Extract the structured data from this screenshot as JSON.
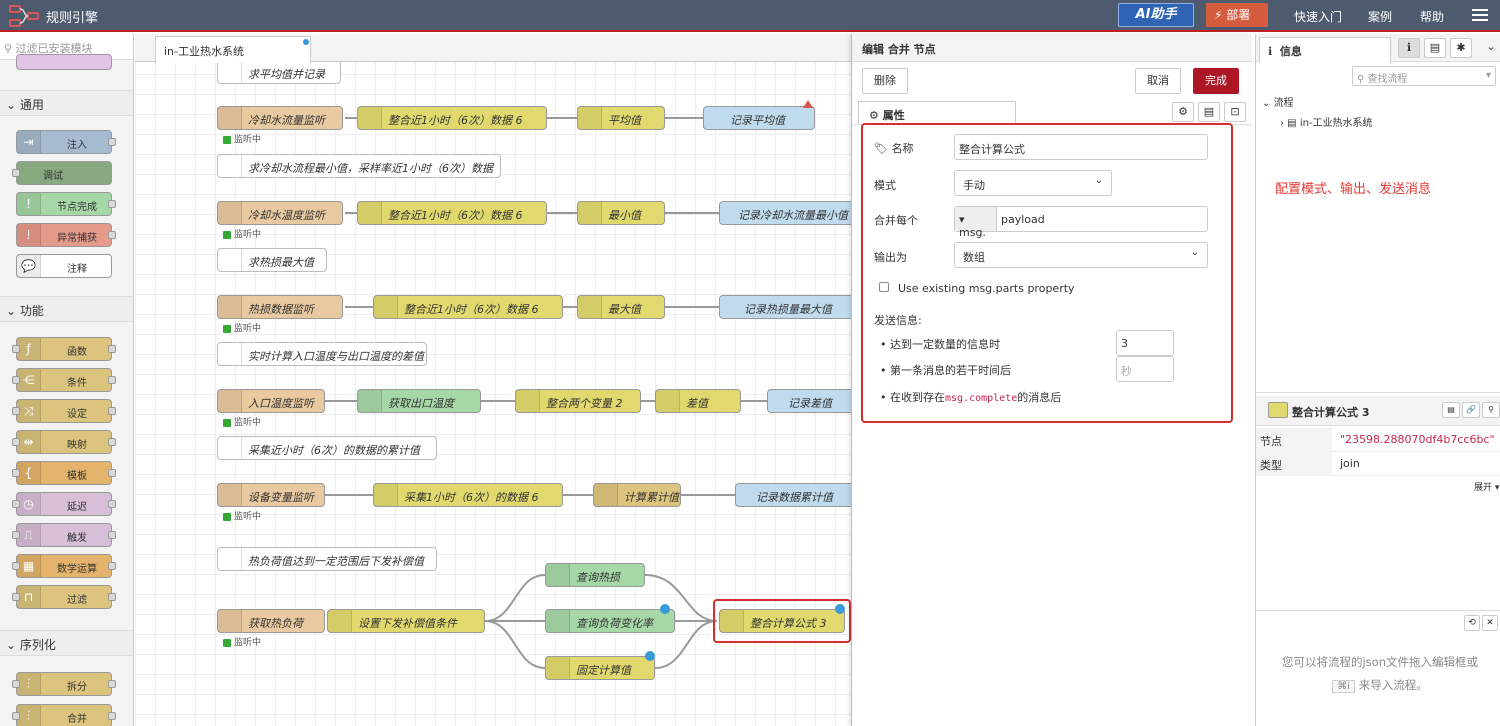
{
  "app": {
    "title": "规则引擎"
  },
  "header": {
    "ai_button": "AI助手",
    "deploy": "部署",
    "quick_start": "快速入门",
    "cases": "案例",
    "help": "帮助"
  },
  "palette": {
    "filter_placeholder": "过滤已安装模块",
    "categories": [
      {
        "label": "通用",
        "nodes": [
          "注入",
          "调试",
          "节点完成",
          "异常捕获",
          "注释"
        ]
      },
      {
        "label": "功能",
        "nodes": [
          "函数",
          "条件",
          "设定",
          "映射",
          "模板",
          "延迟",
          "触发",
          "数学运算",
          "过滤"
        ]
      },
      {
        "label": "序列化",
        "nodes": [
          "拆分",
          "合并"
        ]
      }
    ]
  },
  "workspace": {
    "tab_label": "in-工业热水系统",
    "status_text": "监听中",
    "comments": [
      "求平均值并记录",
      "求冷却水流程最小值，采样率近1小时（6次）数据",
      "求热损最大值",
      "实时计算入口温度与出口温度的差值",
      "采集近小时（6次）的数据的累计值",
      "热负荷值达到一定范围后下发补偿值"
    ],
    "rows": [
      [
        "冷却水流量监听",
        "整合近1小时（6次）数据 6",
        "平均值",
        "记录平均值"
      ],
      [
        "冷却水温度监听",
        "整合近1小时（6次）数据 6",
        "最小值",
        "记录冷却水流量最小值"
      ],
      [
        "热损数据监听",
        "整合近1小时（6次）数据 6",
        "最大值",
        "记录热损量最大值"
      ],
      [
        "入口温度监听",
        "获取出口温度",
        "整合两个变量 2",
        "差值",
        "记录差值"
      ],
      [
        "设备变量监听",
        "采集1小时（6次）的数据 6",
        "计算累计值",
        "记录数据累计值"
      ],
      [
        "获取热负荷",
        "设置下发补偿值条件",
        "查询热损",
        "查询负荷变化率",
        "固定计算值",
        "整合计算公式 3"
      ]
    ]
  },
  "editor": {
    "title": "编辑 合并 节点",
    "delete": "删除",
    "cancel": "取消",
    "done": "完成",
    "tab_properties": "属性",
    "fields": {
      "name_label": "名称",
      "name_value": "整合计算公式",
      "mode_label": "模式",
      "mode_value": "手动",
      "combine_label": "合并每个",
      "combine_prefix": "msg.",
      "combine_value": "payload",
      "output_label": "输出为",
      "output_value": "数组",
      "use_parts": "Use existing msg.parts property",
      "send_label": "发送信息:",
      "send_count_label": "达到一定数量的信息时",
      "send_count_value": "3",
      "send_time_label": "第一条消息的若干时间后",
      "send_time_placeholder": "秒",
      "send_complete_pre": "在收到存在",
      "send_complete_code": "msg.complete",
      "send_complete_post": "的消息后"
    }
  },
  "annotation": "配置模式、输出、发送消息",
  "sidebar": {
    "tab_info": "信息",
    "search_placeholder": "查找流程",
    "tree_root": "流程",
    "tree_item": "in-工业热水系统",
    "node_title": "整合计算公式 3",
    "rows": [
      {
        "k": "节点",
        "v": "\"23598.288070df4b7cc6bc\""
      },
      {
        "k": "类型",
        "v": "join"
      }
    ],
    "expand": "展开",
    "help_text1": "您可以将流程的json文件拖入编辑框或",
    "help_key": "⌘i",
    "help_text2": "来导入流程。"
  }
}
